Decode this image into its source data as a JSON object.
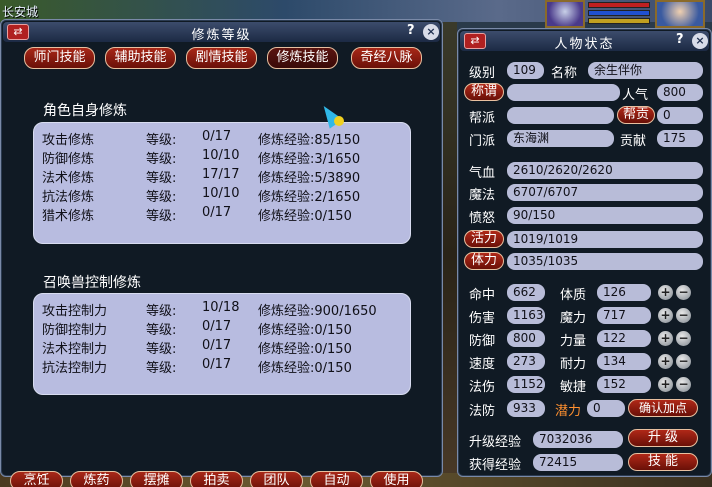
{
  "scene": {
    "city": "长安城"
  },
  "left_window": {
    "title": "修炼等级",
    "swap_icon": "⇄",
    "help": "?",
    "close": "×",
    "tabs": [
      "师门技能",
      "辅助技能",
      "剧情技能",
      "修炼技能",
      "奇经八脉"
    ],
    "active_tab": "修炼技能",
    "char_section": {
      "title": "角色自身修炼",
      "rows": [
        {
          "name": "攻击修炼",
          "level_label": "等级:",
          "level": "0/17",
          "exp": "修炼经验:85/150"
        },
        {
          "name": "防御修炼",
          "level_label": "等级:",
          "level": "10/10",
          "exp": "修炼经验:3/1650"
        },
        {
          "name": "法术修炼",
          "level_label": "等级:",
          "level": "17/17",
          "exp": "修炼经验:5/3890"
        },
        {
          "name": "抗法修炼",
          "level_label": "等级:",
          "level": "10/10",
          "exp": "修炼经验:2/1650"
        },
        {
          "name": "猎术修炼",
          "level_label": "等级:",
          "level": "0/17",
          "exp": "修炼经验:0/150"
        }
      ]
    },
    "pet_section": {
      "title": "召唤兽控制修炼",
      "rows": [
        {
          "name": "攻击控制力",
          "level_label": "等级:",
          "level": "10/18",
          "exp": "修炼经验:900/1650"
        },
        {
          "name": "防御控制力",
          "level_label": "等级:",
          "level": "0/17",
          "exp": "修炼经验:0/150"
        },
        {
          "name": "法术控制力",
          "level_label": "等级:",
          "level": "0/17",
          "exp": "修炼经验:0/150"
        },
        {
          "name": "抗法控制力",
          "level_label": "等级:",
          "level": "0/17",
          "exp": "修炼经验:0/150"
        }
      ]
    },
    "bottom_buttons": [
      "烹饪",
      "炼药",
      "摆摊",
      "拍卖",
      "团队",
      "自动",
      "使用"
    ]
  },
  "right_window": {
    "title": "人物状态",
    "swap_icon": "⇄",
    "help": "?",
    "close": "×",
    "level_label": "级别",
    "level": "109",
    "name_label": "名称",
    "name": "余生伴你",
    "title_btn": "称谓",
    "title_val": "",
    "pop_label": "人气",
    "pop": "800",
    "sect_label": "帮派",
    "sect": "",
    "contrib_btn": "帮贡",
    "contrib": "0",
    "school_label": "门派",
    "school": "东海渊",
    "offer_label": "贡献",
    "offer": "175",
    "hp_label": "气血",
    "hp": "2610/2620/2620",
    "mp_label": "魔法",
    "mp": "6707/6707",
    "anger_label": "愤怒",
    "anger": "90/150",
    "vit_btn": "活力",
    "vit": "1019/1019",
    "sta_btn": "体力",
    "sta": "1035/1035",
    "stats": [
      {
        "label": "命中",
        "value": "662",
        "attr": "体质",
        "attr_val": "126"
      },
      {
        "label": "伤害",
        "value": "1163",
        "attr": "魔力",
        "attr_val": "717"
      },
      {
        "label": "防御",
        "value": "800",
        "attr": "力量",
        "attr_val": "122"
      },
      {
        "label": "速度",
        "value": "273",
        "attr": "耐力",
        "attr_val": "134"
      },
      {
        "label": "法伤",
        "value": "1152",
        "attr": "敏捷",
        "attr_val": "152"
      }
    ],
    "mdef_label": "法防",
    "mdef": "933",
    "potential_label": "潜力",
    "potential": "0",
    "confirm_btn": "确认加点",
    "upexp_label": "升级经验",
    "upexp": "7032036",
    "upgrade_btn": "升 级",
    "gotexp_label": "获得经验",
    "gotexp": "72415",
    "skill_btn": "技 能"
  }
}
